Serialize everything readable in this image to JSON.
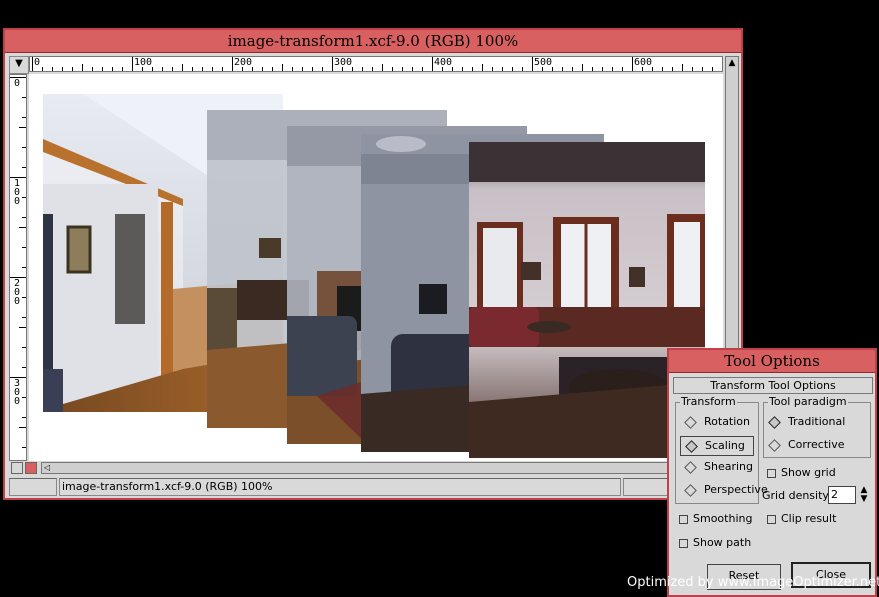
{
  "image_window": {
    "title": "image-transform1.xcf-9.0 (RGB) 100%",
    "status": "image-transform1.xcf-9.0 (RGB) 100%",
    "hruler_labels": [
      "0",
      "100",
      "200",
      "300",
      "400",
      "500",
      "600"
    ],
    "vruler_labels": [
      "0",
      "100",
      "200",
      "300"
    ],
    "corner_glyph": "▼",
    "vscroll_glyph": "▲",
    "nav_left_glyph": "◁"
  },
  "tool_options": {
    "title": "Tool Options",
    "header": "Transform Tool Options",
    "transform_group": {
      "title": "Transform",
      "options": [
        "Rotation",
        "Scaling",
        "Shearing",
        "Perspective"
      ],
      "selected": "Scaling"
    },
    "paradigm_group": {
      "title": "Tool paradigm",
      "options": [
        "Traditional",
        "Corrective"
      ],
      "selected": "Traditional"
    },
    "show_grid_label": "Show grid",
    "show_grid": false,
    "grid_density_label": "Grid density:",
    "grid_density_value": "2",
    "smoothing_label": "Smoothing",
    "smoothing": false,
    "clip_result_label": "Clip result",
    "clip_result": false,
    "show_path_label": "Show path",
    "show_path": false,
    "reset_label": "Reset",
    "close_label": "Close"
  },
  "watermark": "Optimized by www.ImageOptimizer.net",
  "colors": {
    "titlebar": "#d96060",
    "border": "#c0404a",
    "panel": "#d9d9d9"
  }
}
